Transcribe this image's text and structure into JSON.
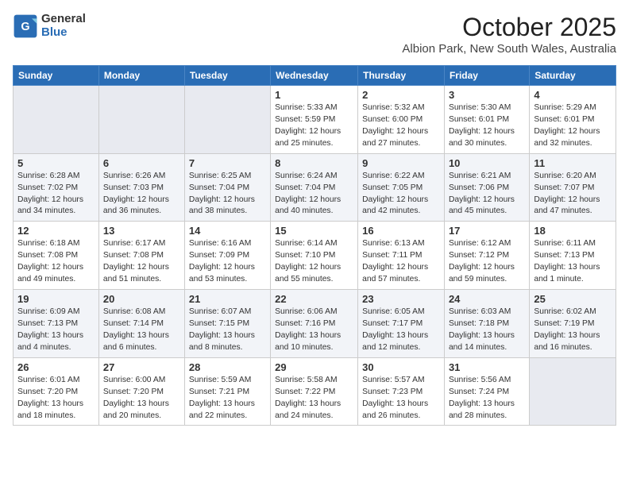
{
  "header": {
    "logo_general": "General",
    "logo_blue": "Blue",
    "month": "October 2025",
    "location": "Albion Park, New South Wales, Australia"
  },
  "days_of_week": [
    "Sunday",
    "Monday",
    "Tuesday",
    "Wednesday",
    "Thursday",
    "Friday",
    "Saturday"
  ],
  "weeks": [
    [
      {
        "day": "",
        "info": ""
      },
      {
        "day": "",
        "info": ""
      },
      {
        "day": "",
        "info": ""
      },
      {
        "day": "1",
        "info": "Sunrise: 5:33 AM\nSunset: 5:59 PM\nDaylight: 12 hours and 25 minutes."
      },
      {
        "day": "2",
        "info": "Sunrise: 5:32 AM\nSunset: 6:00 PM\nDaylight: 12 hours and 27 minutes."
      },
      {
        "day": "3",
        "info": "Sunrise: 5:30 AM\nSunset: 6:01 PM\nDaylight: 12 hours and 30 minutes."
      },
      {
        "day": "4",
        "info": "Sunrise: 5:29 AM\nSunset: 6:01 PM\nDaylight: 12 hours and 32 minutes."
      }
    ],
    [
      {
        "day": "5",
        "info": "Sunrise: 6:28 AM\nSunset: 7:02 PM\nDaylight: 12 hours and 34 minutes."
      },
      {
        "day": "6",
        "info": "Sunrise: 6:26 AM\nSunset: 7:03 PM\nDaylight: 12 hours and 36 minutes."
      },
      {
        "day": "7",
        "info": "Sunrise: 6:25 AM\nSunset: 7:04 PM\nDaylight: 12 hours and 38 minutes."
      },
      {
        "day": "8",
        "info": "Sunrise: 6:24 AM\nSunset: 7:04 PM\nDaylight: 12 hours and 40 minutes."
      },
      {
        "day": "9",
        "info": "Sunrise: 6:22 AM\nSunset: 7:05 PM\nDaylight: 12 hours and 42 minutes."
      },
      {
        "day": "10",
        "info": "Sunrise: 6:21 AM\nSunset: 7:06 PM\nDaylight: 12 hours and 45 minutes."
      },
      {
        "day": "11",
        "info": "Sunrise: 6:20 AM\nSunset: 7:07 PM\nDaylight: 12 hours and 47 minutes."
      }
    ],
    [
      {
        "day": "12",
        "info": "Sunrise: 6:18 AM\nSunset: 7:08 PM\nDaylight: 12 hours and 49 minutes."
      },
      {
        "day": "13",
        "info": "Sunrise: 6:17 AM\nSunset: 7:08 PM\nDaylight: 12 hours and 51 minutes."
      },
      {
        "day": "14",
        "info": "Sunrise: 6:16 AM\nSunset: 7:09 PM\nDaylight: 12 hours and 53 minutes."
      },
      {
        "day": "15",
        "info": "Sunrise: 6:14 AM\nSunset: 7:10 PM\nDaylight: 12 hours and 55 minutes."
      },
      {
        "day": "16",
        "info": "Sunrise: 6:13 AM\nSunset: 7:11 PM\nDaylight: 12 hours and 57 minutes."
      },
      {
        "day": "17",
        "info": "Sunrise: 6:12 AM\nSunset: 7:12 PM\nDaylight: 12 hours and 59 minutes."
      },
      {
        "day": "18",
        "info": "Sunrise: 6:11 AM\nSunset: 7:13 PM\nDaylight: 13 hours and 1 minute."
      }
    ],
    [
      {
        "day": "19",
        "info": "Sunrise: 6:09 AM\nSunset: 7:13 PM\nDaylight: 13 hours and 4 minutes."
      },
      {
        "day": "20",
        "info": "Sunrise: 6:08 AM\nSunset: 7:14 PM\nDaylight: 13 hours and 6 minutes."
      },
      {
        "day": "21",
        "info": "Sunrise: 6:07 AM\nSunset: 7:15 PM\nDaylight: 13 hours and 8 minutes."
      },
      {
        "day": "22",
        "info": "Sunrise: 6:06 AM\nSunset: 7:16 PM\nDaylight: 13 hours and 10 minutes."
      },
      {
        "day": "23",
        "info": "Sunrise: 6:05 AM\nSunset: 7:17 PM\nDaylight: 13 hours and 12 minutes."
      },
      {
        "day": "24",
        "info": "Sunrise: 6:03 AM\nSunset: 7:18 PM\nDaylight: 13 hours and 14 minutes."
      },
      {
        "day": "25",
        "info": "Sunrise: 6:02 AM\nSunset: 7:19 PM\nDaylight: 13 hours and 16 minutes."
      }
    ],
    [
      {
        "day": "26",
        "info": "Sunrise: 6:01 AM\nSunset: 7:20 PM\nDaylight: 13 hours and 18 minutes."
      },
      {
        "day": "27",
        "info": "Sunrise: 6:00 AM\nSunset: 7:20 PM\nDaylight: 13 hours and 20 minutes."
      },
      {
        "day": "28",
        "info": "Sunrise: 5:59 AM\nSunset: 7:21 PM\nDaylight: 13 hours and 22 minutes."
      },
      {
        "day": "29",
        "info": "Sunrise: 5:58 AM\nSunset: 7:22 PM\nDaylight: 13 hours and 24 minutes."
      },
      {
        "day": "30",
        "info": "Sunrise: 5:57 AM\nSunset: 7:23 PM\nDaylight: 13 hours and 26 minutes."
      },
      {
        "day": "31",
        "info": "Sunrise: 5:56 AM\nSunset: 7:24 PM\nDaylight: 13 hours and 28 minutes."
      },
      {
        "day": "",
        "info": ""
      }
    ]
  ]
}
